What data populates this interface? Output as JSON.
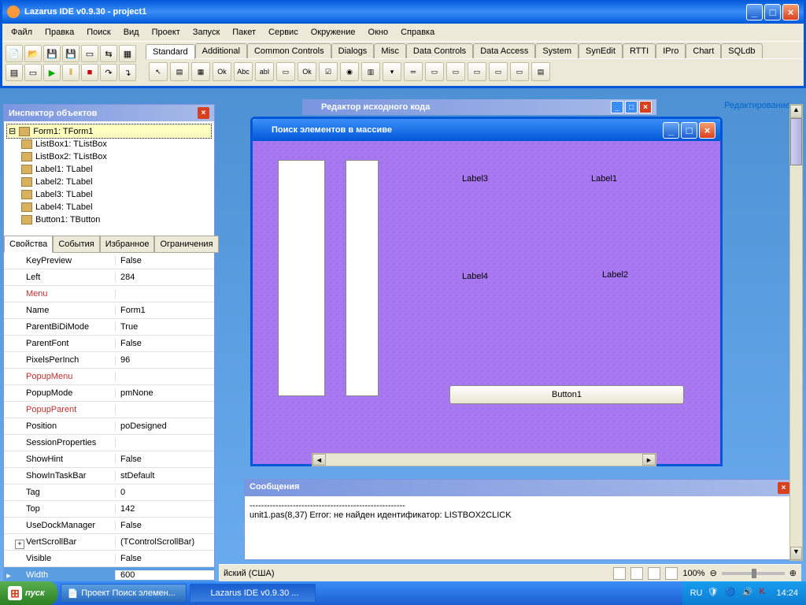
{
  "main_window": {
    "title": "Lazarus IDE v0.9.30 - project1"
  },
  "menu": [
    "Файл",
    "Правка",
    "Поиск",
    "Вид",
    "Проект",
    "Запуск",
    "Пакет",
    "Сервис",
    "Окружение",
    "Окно",
    "Справка"
  ],
  "tabs": [
    "Standard",
    "Additional",
    "Common Controls",
    "Dialogs",
    "Misc",
    "Data Controls",
    "Data Access",
    "System",
    "SynEdit",
    "RTTI",
    "IPro",
    "Chart",
    "SQLdb"
  ],
  "palette_labels": {
    "ok1": "Ok",
    "abc": "Abc",
    "abl": "abI",
    "ok2": "Ok"
  },
  "inspector": {
    "title": "Инспектор объектов",
    "tree": [
      {
        "label": "Form1: TForm1",
        "root": true,
        "selected": true
      },
      {
        "label": "ListBox1: TListBox"
      },
      {
        "label": "ListBox2: TListBox"
      },
      {
        "label": "Label1: TLabel"
      },
      {
        "label": "Label2: TLabel"
      },
      {
        "label": "Label3: TLabel"
      },
      {
        "label": "Label4: TLabel"
      },
      {
        "label": "Button1: TButton"
      }
    ],
    "prop_tabs": [
      "Свойства",
      "События",
      "Избранное",
      "Ограничения"
    ],
    "props": [
      {
        "name": "KeyPreview",
        "val": "False"
      },
      {
        "name": "Left",
        "val": "284"
      },
      {
        "name": "Menu",
        "val": "",
        "red": true
      },
      {
        "name": "Name",
        "val": "Form1"
      },
      {
        "name": "ParentBiDiMode",
        "val": "True"
      },
      {
        "name": "ParentFont",
        "val": "False"
      },
      {
        "name": "PixelsPerInch",
        "val": "96"
      },
      {
        "name": "PopupMenu",
        "val": "",
        "red": true
      },
      {
        "name": "PopupMode",
        "val": "pmNone"
      },
      {
        "name": "PopupParent",
        "val": "",
        "red": true
      },
      {
        "name": "Position",
        "val": "poDesigned"
      },
      {
        "name": "SessionProperties",
        "val": ""
      },
      {
        "name": "ShowHint",
        "val": "False"
      },
      {
        "name": "ShowInTaskBar",
        "val": "stDefault"
      },
      {
        "name": "Tag",
        "val": "0"
      },
      {
        "name": "Top",
        "val": "142"
      },
      {
        "name": "UseDockManager",
        "val": "False"
      },
      {
        "name": "VertScrollBar",
        "val": "(TControlScrollBar)",
        "exp": true
      },
      {
        "name": "Visible",
        "val": "False"
      },
      {
        "name": "Width",
        "val": "600",
        "selected": true
      }
    ]
  },
  "editor_title": "Редактор исходного кода",
  "edit_link": "Редактирование",
  "form": {
    "title": "Поиск элементов в массиве",
    "label1": "Label1",
    "label2": "Label2",
    "label3": "Label3",
    "label4": "Label4",
    "button": "Button1"
  },
  "messages": {
    "title": "Сообщения",
    "line1": "------------------------------------------------------",
    "line2": "unit1.pas(8,37) Error: не найден идентификатор: LISTBOX2CLICK"
  },
  "statusbar": {
    "lang": "йский (США)",
    "zoom": "100%"
  },
  "taskbar": {
    "start": "пуск",
    "task1": "Проект Поиск элемен...",
    "task2": "Lazarus IDE v0.9.30 ...",
    "lang": "RU",
    "time": "14:24"
  }
}
